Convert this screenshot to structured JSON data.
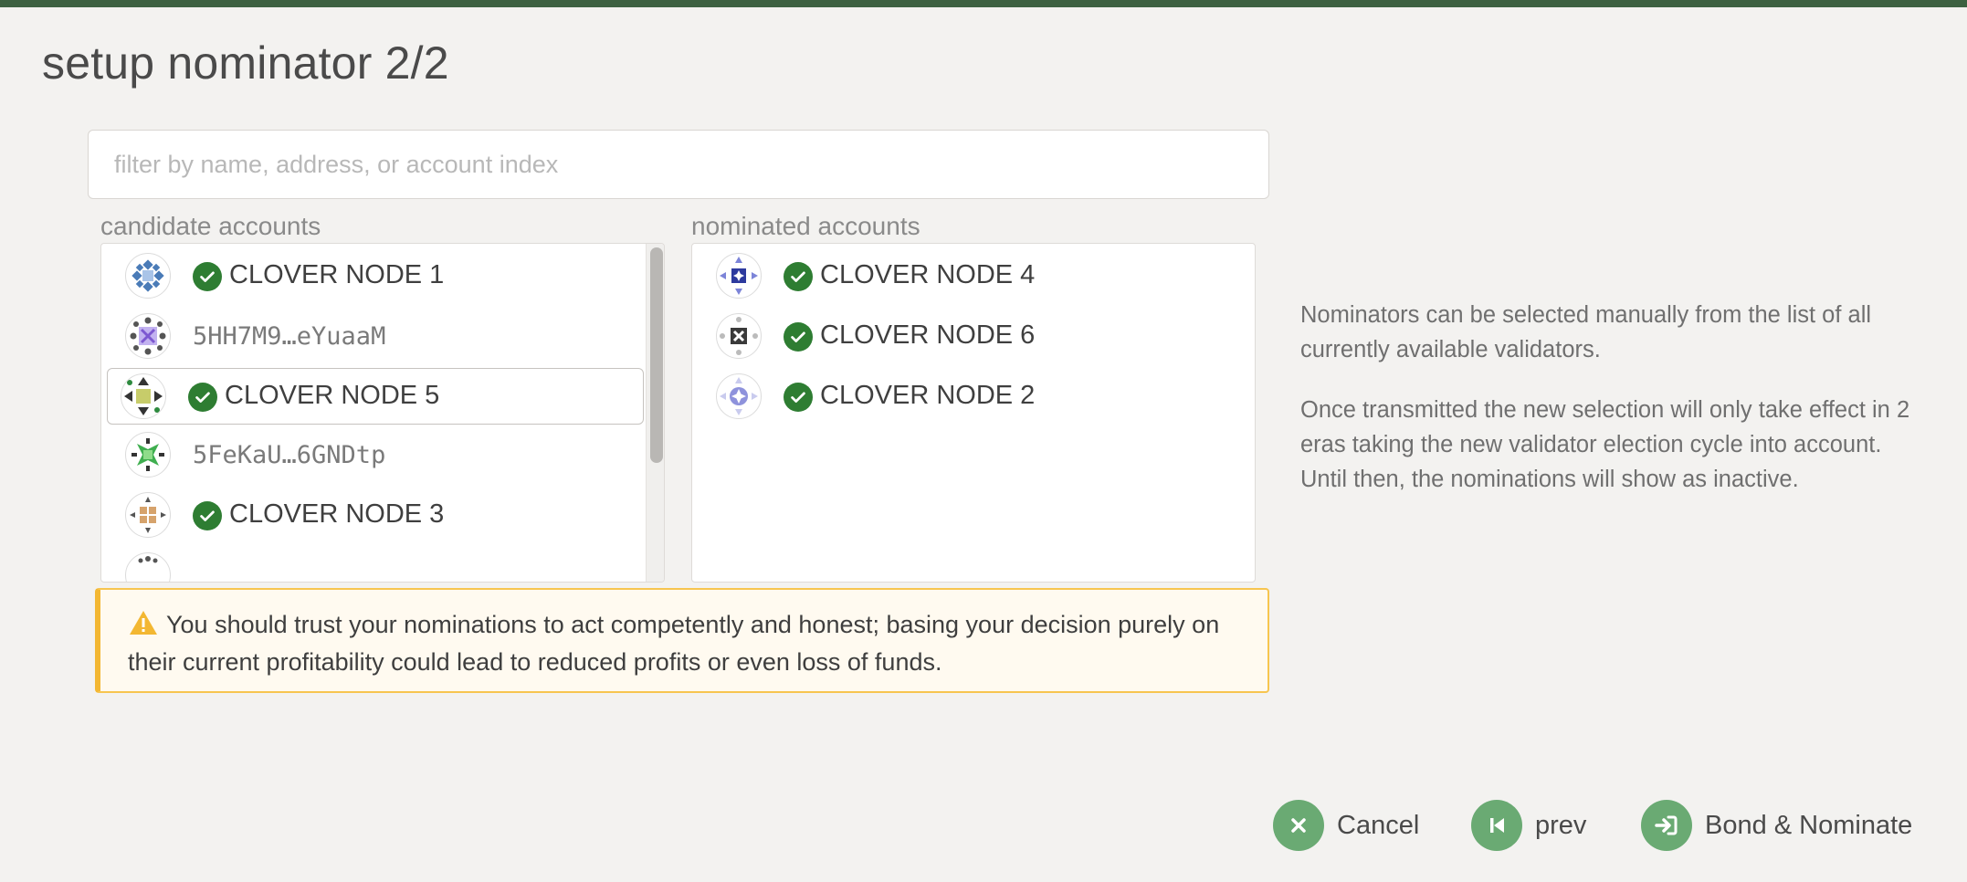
{
  "modal": {
    "title": "setup nominator 2/2"
  },
  "search": {
    "placeholder": "filter by name, address, or account index",
    "value": ""
  },
  "candidates": {
    "label": "candidate accounts",
    "items": [
      {
        "name": "CLOVER NODE 1",
        "verified": true
      },
      {
        "name": "5HH7M9…eYuaaM",
        "verified": false
      },
      {
        "name": "CLOVER NODE 5",
        "verified": true,
        "selected": true
      },
      {
        "name": "5FeKaU…6GNDtp",
        "verified": false
      },
      {
        "name": "CLOVER NODE 3",
        "verified": true
      }
    ]
  },
  "nominated": {
    "label": "nominated accounts",
    "items": [
      {
        "name": "CLOVER NODE 4",
        "verified": true
      },
      {
        "name": "CLOVER NODE 6",
        "verified": true
      },
      {
        "name": "CLOVER NODE 2",
        "verified": true
      }
    ]
  },
  "warning": {
    "text": "You should trust your nominations to act competently and honest; basing your decision purely on their current profitability could lead to reduced profits or even loss of funds.",
    "icon": "warning-triangle-icon"
  },
  "help": {
    "p1": "Nominators can be selected manually from the list of all currently available validators.",
    "p2": "Once transmitted the new selection will only take effect in 2 eras taking the new validator election cycle into account. Until then, the nominations will show as inactive."
  },
  "actions": {
    "cancel": "Cancel",
    "prev": "prev",
    "bond": "Bond & Nominate"
  },
  "colors": {
    "header_bar": "#3d6141",
    "verified": "#2e7d32",
    "button": "#6aaa73",
    "warning_border": "#f3b732"
  }
}
